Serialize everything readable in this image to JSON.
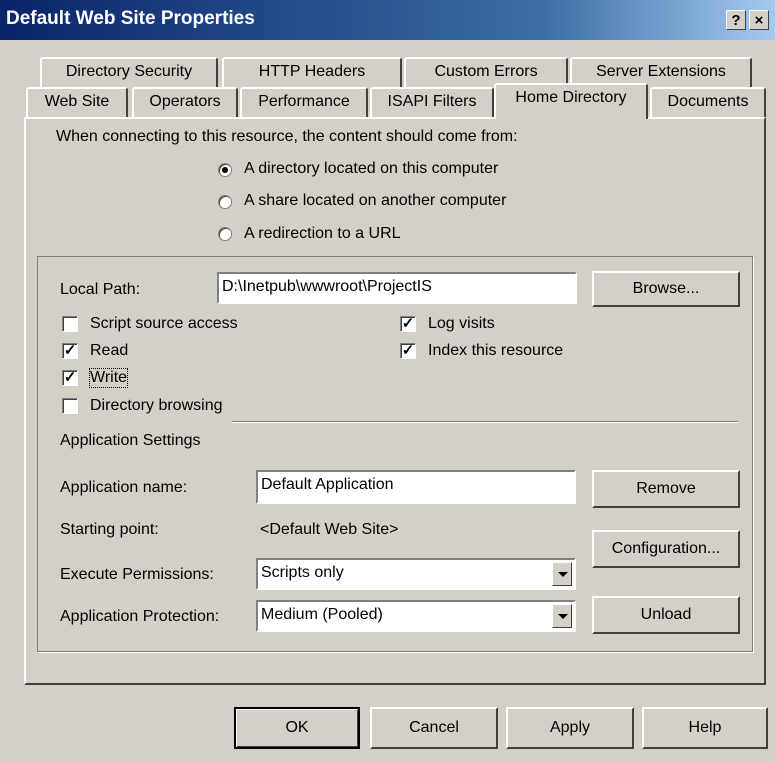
{
  "window": {
    "title": "Default Web Site Properties",
    "help_btn": "?",
    "close_btn": "×"
  },
  "tabs_back": [
    "Directory Security",
    "HTTP Headers",
    "Custom Errors",
    "Server Extensions"
  ],
  "tabs_front": [
    "Web Site",
    "Operators",
    "Performance",
    "ISAPI Filters",
    "Home Directory",
    "Documents"
  ],
  "active_tab": "Home Directory",
  "content": {
    "intro": "When connecting to this resource, the content should come from:",
    "radios": [
      {
        "label": "A directory located on this computer",
        "selected": true
      },
      {
        "label": "A share located on another computer",
        "selected": false
      },
      {
        "label": "A redirection to a URL",
        "selected": false
      }
    ]
  },
  "local_path": {
    "label": "Local Path:",
    "value": "D:\\Inetpub\\wwwroot\\ProjectIS",
    "browse": "Browse..."
  },
  "checkboxes": [
    {
      "label": "Script source access",
      "checked": false
    },
    {
      "label": "Read",
      "checked": true
    },
    {
      "label": "Write",
      "checked": true
    },
    {
      "label": "Directory browsing",
      "checked": false
    },
    {
      "label": "Log visits",
      "checked": true
    },
    {
      "label": "Index this resource",
      "checked": true
    }
  ],
  "app": {
    "section": "Application Settings",
    "name_label": "Application name:",
    "name_value": "Default Application",
    "remove": "Remove",
    "start_label": "Starting point:",
    "start_value": "<Default Web Site>",
    "config": "Configuration...",
    "exec_label": "Execute Permissions:",
    "exec_value": "Scripts only",
    "prot_label": "Application Protection:",
    "prot_value": "Medium (Pooled)",
    "unload": "Unload"
  },
  "footer": {
    "ok": "OK",
    "cancel": "Cancel",
    "apply": "Apply",
    "help": "Help"
  }
}
